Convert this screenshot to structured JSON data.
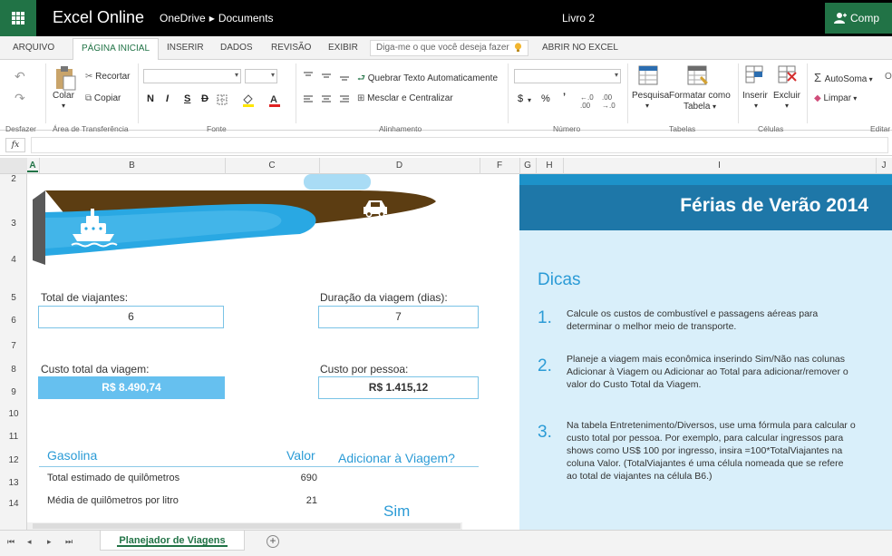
{
  "app": {
    "title": "Excel Online",
    "breadcrumb": [
      "OneDrive",
      "Documents"
    ],
    "doc_name": "Livro 2",
    "share_label": "Comp"
  },
  "menu": {
    "tabs": [
      "ARQUIVO",
      "PÁGINA INICIAL",
      "INSERIR",
      "DADOS",
      "REVISÃO",
      "EXIBIR"
    ],
    "active_tab": "PÁGINA INICIAL",
    "tell_me_placeholder": "Diga-me o que você deseja fazer",
    "open_in_excel": "ABRIR NO EXCEL"
  },
  "ribbon": {
    "groups": {
      "undo": "Desfazer",
      "clipboard": "Área de Transferência",
      "font": "Fonte",
      "alignment": "Alinhamento",
      "number": "Número",
      "tables": "Tabelas",
      "cells": "Células",
      "editing": "Editar"
    },
    "paste": "Colar",
    "cut": "Recortar",
    "copy": "Copiar",
    "format_letters": [
      "N",
      "I",
      "S",
      "D"
    ],
    "wrap_text": "Quebrar Texto Automaticamente",
    "merge_center": "Mesclar e Centralizar",
    "currency": "$",
    "percent": "%",
    "comma": "’",
    "search": "Pesquisa",
    "format_table_1": "Formatar como",
    "format_table_2": "Tabela",
    "insert": "Inserir",
    "delete": "Excluir",
    "autosum": "AutoSoma",
    "clear": "Limpar",
    "fx": "fx"
  },
  "columns": [
    "A",
    "B",
    "C",
    "D",
    "F",
    "G",
    "H",
    "I",
    "J"
  ],
  "rows": [
    "2",
    "3",
    "4",
    "5",
    "6",
    "7",
    "8",
    "9",
    "10",
    "11",
    "12",
    "13",
    "14"
  ],
  "sheet": {
    "total_travelers_label": "Total de viajantes:",
    "total_travelers": "6",
    "trip_duration_label": "Duração da viagem (dias):",
    "trip_duration": "7",
    "total_cost_label": "Custo total da viagem:",
    "total_cost": "R$ 8.490,74",
    "cost_per_person_label": "Custo por pessoa:",
    "cost_per_person": "R$ 1.415,12",
    "gas_table": {
      "title": "Gasolina",
      "value_header": "Valor",
      "add_header": "Adicionar à Viagem?",
      "rows": [
        {
          "label": "Total estimado de quilômetros",
          "value": "690"
        },
        {
          "label": "Média de quilômetros por litro",
          "value": "21"
        }
      ],
      "add_value": "Sim"
    }
  },
  "panel": {
    "title": "Férias de Verão 2014",
    "heading": "Dicas",
    "tips": [
      {
        "num": "1.",
        "text": "Calcule os custos de combustível e passagens aéreas para determinar o melhor meio de transporte."
      },
      {
        "num": "2.",
        "text": "Planeje a viagem mais econômica inserindo Sim/Não nas colunas Adicionar à Viagem ou Adicionar ao Total para adicionar/remover o valor do Custo Total da Viagem."
      },
      {
        "num": "3.",
        "text": "Na tabela Entretenimento/Diversos, use uma fórmula para calcular o custo total por pessoa. Por exemplo, para calcular ingressos para shows como US$ 100 por ingresso, insira =100*TotalViajantes na coluna Valor. (TotalViajantes é uma célula nomeada que se refere ao total de viajantes na célula B6.)"
      }
    ]
  },
  "bottom": {
    "sheet_tab": "Planejador de Viagens",
    "add_sheet": "+"
  },
  "colors": {
    "excel_green": "#217346",
    "accent_blue": "#2b9bd6",
    "banner_blue": "#1e77a8",
    "panel_bg": "#d9effa",
    "cost_fill": "#66c0ef",
    "road_brown": "#5c3d12"
  }
}
